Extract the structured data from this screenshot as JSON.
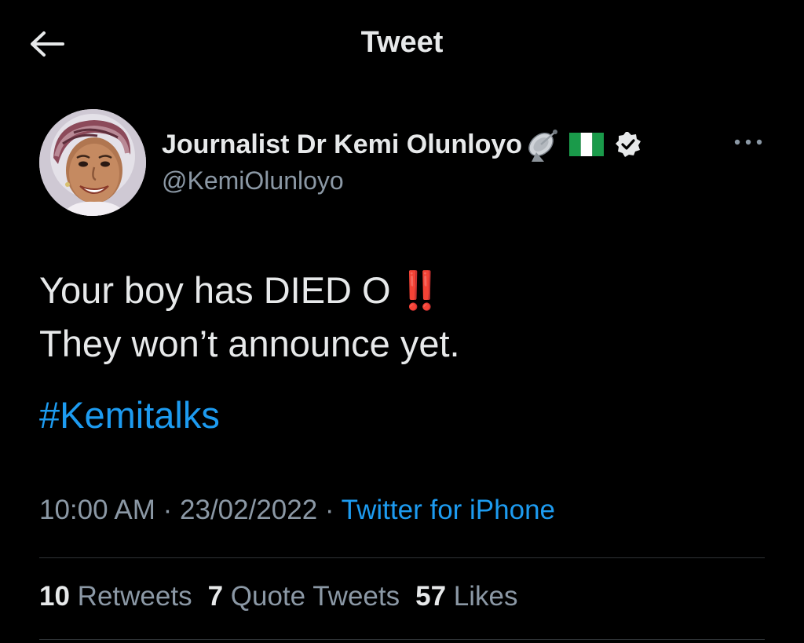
{
  "header": {
    "title": "Tweet",
    "back_icon": "arrow-left-icon"
  },
  "author": {
    "display_name": "Journalist Dr Kemi Olunloyo",
    "handle": "@KemiOlunloyo",
    "name_emojis": [
      "satellite-antenna-icon",
      "nigeria-flag-icon"
    ],
    "verified": true
  },
  "tweet": {
    "line1": "Your boy has DIED O",
    "line1_emoji": "‼️",
    "line2": "They won’t announce yet.",
    "hashtag": "#Kemitalks"
  },
  "meta": {
    "time": "10:00 AM",
    "separator": "·",
    "date": "23/02/2022",
    "source": "Twitter for iPhone"
  },
  "stats": {
    "retweets_count": "10",
    "retweets_label": "Retweets",
    "quotes_count": "7",
    "quotes_label": "Quote Tweets",
    "likes_count": "57",
    "likes_label": "Likes"
  },
  "colors": {
    "background": "#000000",
    "text": "#e7e9ea",
    "muted": "#8b98a5",
    "link": "#1d9bf0",
    "divider": "#2f3336",
    "emoji_red": "#e0262d"
  }
}
